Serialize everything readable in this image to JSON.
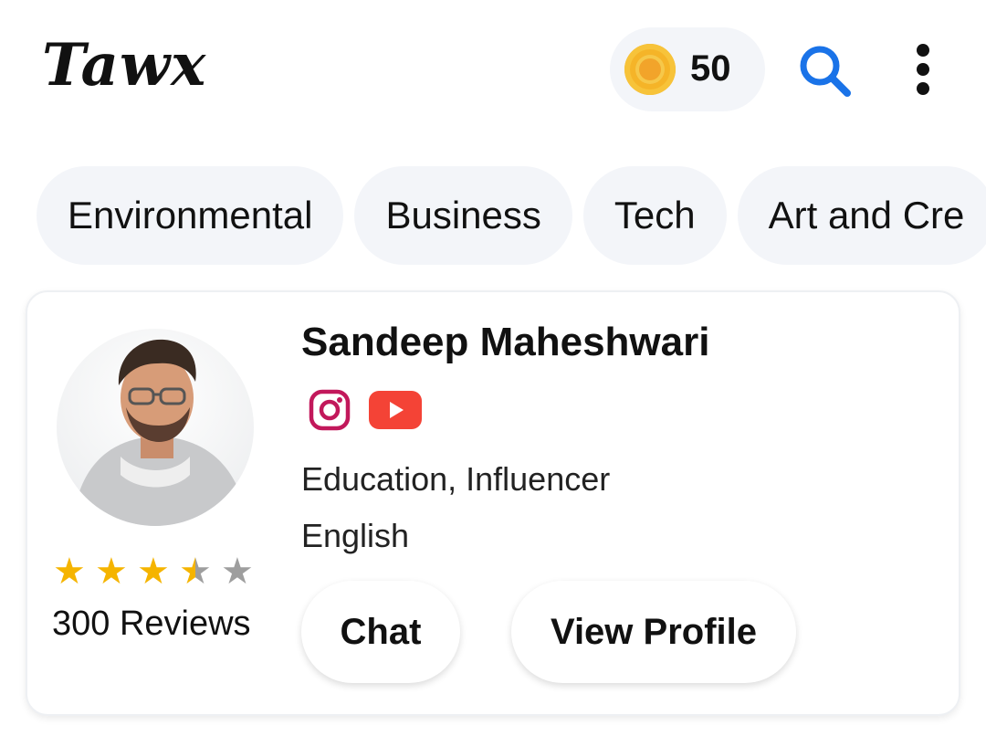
{
  "app": {
    "logo_text": "Tawx"
  },
  "header": {
    "coins": "50",
    "icons": [
      "coin-icon",
      "search-icon",
      "more-vertical-icon"
    ],
    "accent_color": "#1a73e8"
  },
  "categories": [
    "Environmental",
    "Business",
    "Tech",
    "Art and Cre"
  ],
  "profile_card": {
    "name": "Sandeep Maheshwari",
    "social_icons": [
      "instagram-icon",
      "youtube-icon"
    ],
    "category_text": "Education, Influencer",
    "language_text": "English",
    "rating": 3.5,
    "rating_max": 5,
    "reviews_text": "300 Reviews",
    "chat_label": "Chat",
    "view_profile_label": "View Profile",
    "star_color": "#f5b400",
    "star_empty_color": "#9e9e9e"
  }
}
